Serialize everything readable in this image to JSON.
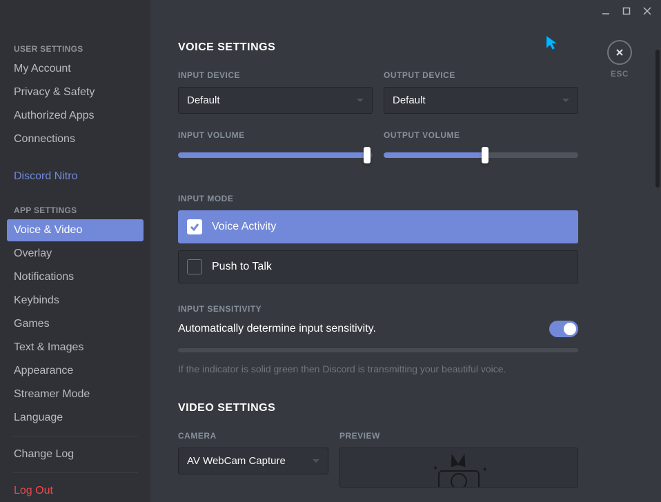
{
  "window": {
    "esc_label": "ESC"
  },
  "sidebar": {
    "user_settings_header": "USER SETTINGS",
    "app_settings_header": "APP SETTINGS",
    "items": {
      "my_account": "My Account",
      "privacy": "Privacy & Safety",
      "authorized_apps": "Authorized Apps",
      "connections": "Connections",
      "nitro": "Discord Nitro",
      "voice_video": "Voice & Video",
      "overlay": "Overlay",
      "notifications": "Notifications",
      "keybinds": "Keybinds",
      "games": "Games",
      "text_images": "Text & Images",
      "appearance": "Appearance",
      "streamer_mode": "Streamer Mode",
      "language": "Language",
      "change_log": "Change Log",
      "log_out": "Log Out"
    }
  },
  "voice": {
    "title": "VOICE SETTINGS",
    "input_device_label": "INPUT DEVICE",
    "output_device_label": "OUTPUT DEVICE",
    "input_device_value": "Default",
    "output_device_value": "Default",
    "input_volume_label": "INPUT VOLUME",
    "output_volume_label": "OUTPUT VOLUME",
    "input_volume_percent": 97,
    "output_volume_percent": 52,
    "input_mode_label": "INPUT MODE",
    "voice_activity": "Voice Activity",
    "push_to_talk": "Push to Talk",
    "input_sensitivity_label": "INPUT SENSITIVITY",
    "auto_sensitivity_text": "Automatically determine input sensitivity.",
    "auto_sensitivity_on": true,
    "hint": "If the indicator is solid green then Discord is transmitting your beautiful voice."
  },
  "video": {
    "title": "VIDEO SETTINGS",
    "camera_label": "CAMERA",
    "preview_label": "PREVIEW",
    "camera_value": "AV WebCam Capture"
  }
}
